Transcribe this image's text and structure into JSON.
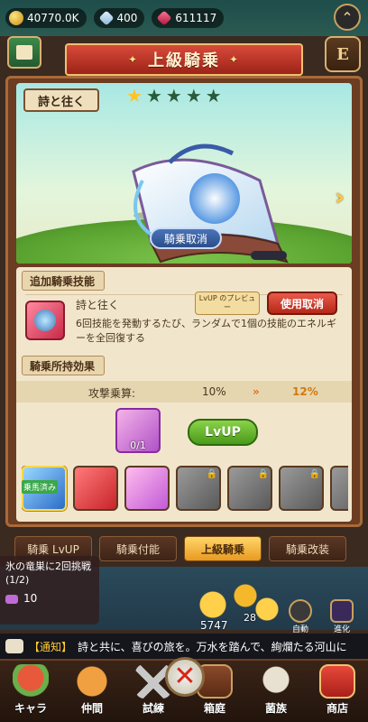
{
  "resources": {
    "coins": "40770.0K",
    "gems": "400",
    "rubies": "611117"
  },
  "header": {
    "title": "上級騎乗"
  },
  "mount": {
    "name": "詩と往く",
    "stars_total": 5,
    "stars_filled": 1,
    "cancel_ride_label": "騎乗取消"
  },
  "skill_section": {
    "heading": "追加騎乗技能",
    "skill_name": "詩と往く",
    "preview_label": "LvUP のプレビュー",
    "use_cancel_label": "使用取消",
    "description": "6回技能を発動するたび、ランダムで1個の技能のエネルギーを全回復する"
  },
  "hold_section": {
    "heading": "騎乗所持効果",
    "stat_label": "攻撃乗算:",
    "stat_current": "10%",
    "stat_arrow": "»",
    "stat_next": "12%",
    "item_count": "0/1",
    "lvup_label": "LvUP"
  },
  "mount_list": [
    {
      "variant": "blue",
      "selected": true,
      "riding_label": "乗馬済み",
      "locked": false
    },
    {
      "variant": "red",
      "selected": false,
      "riding_label": "",
      "locked": false
    },
    {
      "variant": "pink",
      "selected": false,
      "riding_label": "",
      "locked": false
    },
    {
      "variant": "gray",
      "selected": false,
      "riding_label": "",
      "locked": true
    },
    {
      "variant": "gray",
      "selected": false,
      "riding_label": "",
      "locked": true
    },
    {
      "variant": "gray",
      "selected": false,
      "riding_label": "",
      "locked": true
    },
    {
      "variant": "gray",
      "selected": false,
      "riding_label": "",
      "locked": true
    }
  ],
  "tabs": [
    {
      "label": "騎乗 LvUP",
      "active": false
    },
    {
      "label": "騎乗付能",
      "active": false
    },
    {
      "label": "上級騎乗",
      "active": true
    },
    {
      "label": "騎乗改装",
      "active": false
    }
  ],
  "quest": {
    "text": "氷の竜巣に2回挑戦(1/2)",
    "count": "10"
  },
  "battle": {
    "gold_value": "5747",
    "level_value": "28",
    "auto_label": "自動",
    "evolve_label": "進化"
  },
  "notice": {
    "tag": "【通知】",
    "text": "詩と共に、喜びの旅を。万水を踏んで、絢爛たる河山に"
  },
  "nav": [
    {
      "label": "キャラ",
      "icon": "character-icon"
    },
    {
      "label": "仲間",
      "icon": "paw-icon"
    },
    {
      "label": "試練",
      "icon": "swords-icon"
    },
    {
      "label": "箱庭",
      "icon": "box-icon"
    },
    {
      "label": "菌族",
      "icon": "skull-icon"
    },
    {
      "label": "商店",
      "icon": "shop-icon"
    }
  ],
  "colors": {
    "accent_red": "#c8342a",
    "accent_gold": "#ffc42a",
    "wood": "#6b3d22",
    "panel": "#f1e6cc"
  }
}
